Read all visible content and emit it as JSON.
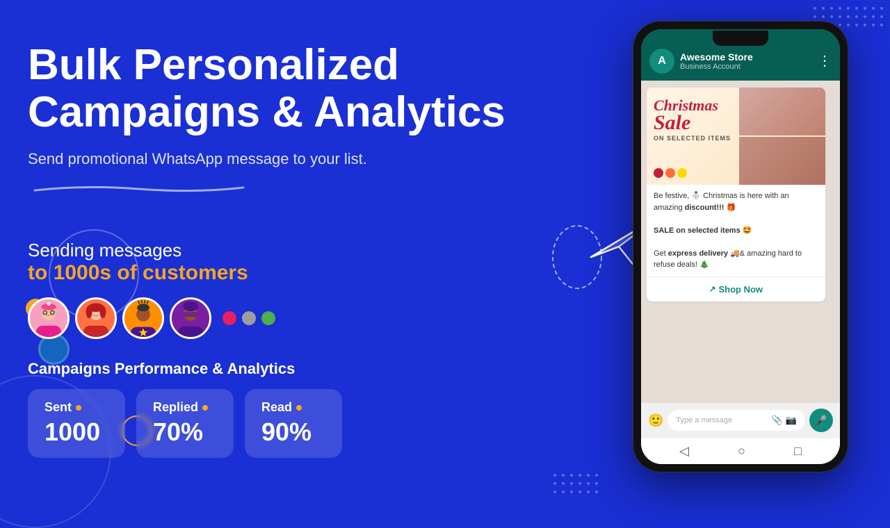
{
  "background": {
    "color": "#1a2fd4"
  },
  "hero": {
    "title_line1": "Bulk Personalized",
    "title_line2": "Campaigns & Analytics",
    "subtitle": "Send promotional WhatsApp message to your list."
  },
  "sending_section": {
    "line1": "Sending messages",
    "line2": "to 1000s of customers"
  },
  "analytics": {
    "title": "Campaigns Performance & Analytics",
    "stats": [
      {
        "label": "Sent",
        "value": "1000",
        "dot_color": "#f5a623"
      },
      {
        "label": "Replied",
        "value": "70%",
        "dot_color": "#f5a623"
      },
      {
        "label": "Read",
        "value": "90%",
        "dot_color": "#f5a623"
      }
    ]
  },
  "phone": {
    "header": {
      "avatar_letter": "A",
      "store_name": "Awesome Store",
      "account_type": "Business Account"
    },
    "message": {
      "sale_image_alt": "Christmas Sale Banner",
      "christmas_text": "Christmas",
      "sale_text": "Sale",
      "on_selected": "ON SELECTED ITEMS",
      "body_text": "Be festive, ⛄ Christmas is here with an amazing ",
      "body_bold1": "discount!!!",
      "body_emoji1": "🎁",
      "sale_line": "SALE on selected items 🤩",
      "delivery_text": "Get ",
      "delivery_bold": "express delivery",
      "delivery_emoji": "🚚",
      "delivery_rest": "& amazing hard to refuse deals! 🎄",
      "shop_btn": "Shop Now"
    },
    "input_placeholder": "Type a message",
    "nav": [
      "◁",
      "○",
      "□"
    ]
  },
  "decorative_dots": {
    "top_right": true,
    "bottom_left": true
  }
}
